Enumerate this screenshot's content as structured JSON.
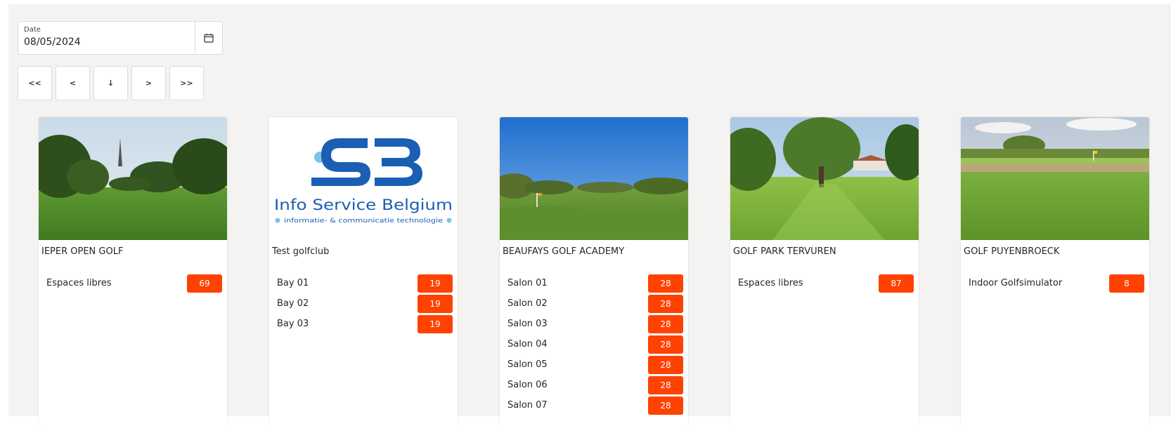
{
  "date": {
    "label": "Date",
    "value": "08/05/2024"
  },
  "nav": {
    "first": "<<",
    "prev": "<",
    "today": "↓",
    "next": ">",
    "last": ">>"
  },
  "logo": {
    "name": "Info Service Belgium",
    "tagline": "informatie- & communicatie technologie"
  },
  "colors": {
    "badge": "#ff4200",
    "logo_blue": "#1a5fb4",
    "logo_light": "#7cc4e8"
  },
  "cards": [
    {
      "title": "IEPER OPEN GOLF",
      "resources": [
        {
          "name": "Espaces libres",
          "count": "69"
        }
      ]
    },
    {
      "title": "Test golfclub",
      "resources": [
        {
          "name": "Bay 01",
          "count": "19"
        },
        {
          "name": "Bay 02",
          "count": "19"
        },
        {
          "name": "Bay 03",
          "count": "19"
        }
      ]
    },
    {
      "title": "BEAUFAYS GOLF ACADEMY",
      "resources": [
        {
          "name": "Salon 01",
          "count": "28"
        },
        {
          "name": "Salon 02",
          "count": "28"
        },
        {
          "name": "Salon 03",
          "count": "28"
        },
        {
          "name": "Salon 04",
          "count": "28"
        },
        {
          "name": "Salon 05",
          "count": "28"
        },
        {
          "name": "Salon 06",
          "count": "28"
        },
        {
          "name": "Salon 07",
          "count": "28"
        }
      ]
    },
    {
      "title": "GOLF PARK TERVUREN",
      "resources": [
        {
          "name": "Espaces libres",
          "count": "87"
        }
      ]
    },
    {
      "title": "GOLF PUYENBROECK",
      "resources": [
        {
          "name": "Indoor Golfsimulator",
          "count": "8"
        }
      ]
    }
  ]
}
